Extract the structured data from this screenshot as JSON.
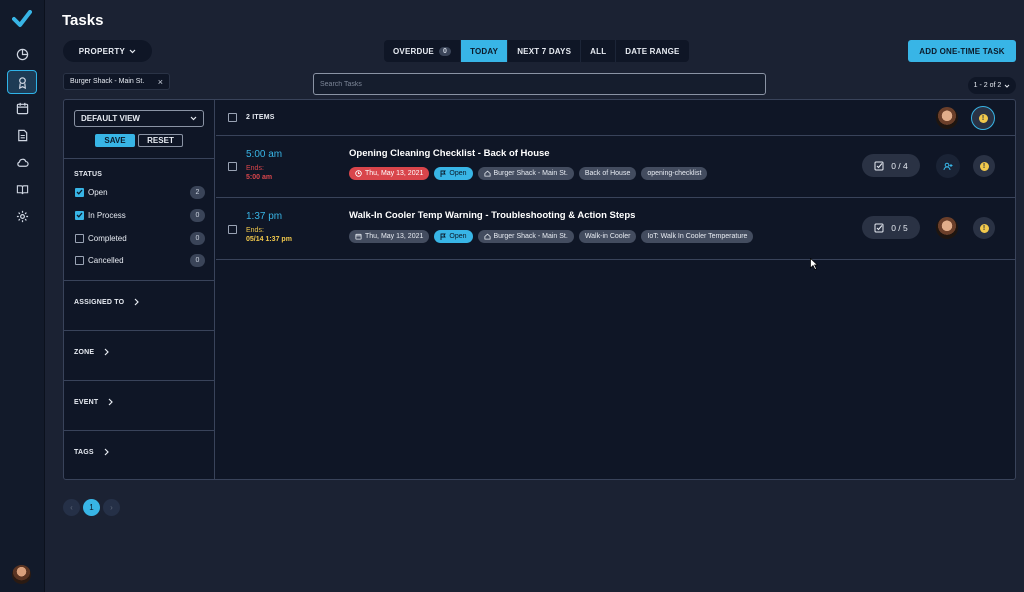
{
  "app": {
    "title": "Tasks"
  },
  "header": {
    "property_label": "PROPERTY",
    "segments": [
      {
        "label": "OVERDUE",
        "count": "0"
      },
      {
        "label": "TODAY"
      },
      {
        "label": "NEXT 7 DAYS"
      },
      {
        "label": "ALL"
      },
      {
        "label": "DATE RANGE"
      }
    ],
    "active_segment": "TODAY",
    "add_label": "ADD ONE-TIME TASK"
  },
  "filter_chip": {
    "label": "Burger Shack - Main St.",
    "close": "×"
  },
  "search": {
    "placeholder": "Search Tasks",
    "value": ""
  },
  "pagination_count": "1 - 2 of 2",
  "filters": {
    "view_select": "DEFAULT VIEW",
    "save_label": "SAVE",
    "reset_label": "RESET",
    "status_title": "STATUS",
    "statuses": [
      {
        "label": "Open",
        "count": "2",
        "checked": true
      },
      {
        "label": "In Process",
        "count": "0",
        "checked": true
      },
      {
        "label": "Completed",
        "count": "0",
        "checked": false
      },
      {
        "label": "Cancelled",
        "count": "0",
        "checked": false
      }
    ],
    "sections": [
      "ASSIGNED TO",
      "ZONE",
      "EVENT",
      "TAGS"
    ]
  },
  "list": {
    "items_label": "2 ITEMS",
    "tasks": [
      {
        "time": "5:00 am",
        "ends_label": "Ends:",
        "ends_value": "5:00 am",
        "title": "Opening Cleaning Checklist - Back of House",
        "date": "Thu, May 13, 2021",
        "status": "Open",
        "tags": [
          "Burger Shack - Main St.",
          "Back of House",
          "opening-checklist"
        ],
        "checklist": "0 / 4"
      },
      {
        "time": "1:37 pm",
        "ends_label": "Ends:",
        "ends_value": "05/14 1:37 pm",
        "title": "Walk-In Cooler Temp Warning - Troubleshooting & Action Steps",
        "date": "Thu, May 13, 2021",
        "status": "Open",
        "tags": [
          "Burger Shack - Main St.",
          "Walk-in Cooler",
          "IoT: Walk In Cooler Temperature"
        ],
        "checklist": "0 / 5"
      }
    ]
  },
  "pager": {
    "prev": "‹",
    "current": "1",
    "next": "›"
  },
  "colors": {
    "accent": "#38b5e6",
    "background": "#1b2233",
    "panel": "#0f1626",
    "danger": "#d9454b",
    "warning": "#f2c94c"
  },
  "icons": [
    "check-logo-icon",
    "dashboard-icon",
    "tasks-icon",
    "calendar-icon",
    "document-icon",
    "cloud-icon",
    "book-icon",
    "gear-icon"
  ]
}
